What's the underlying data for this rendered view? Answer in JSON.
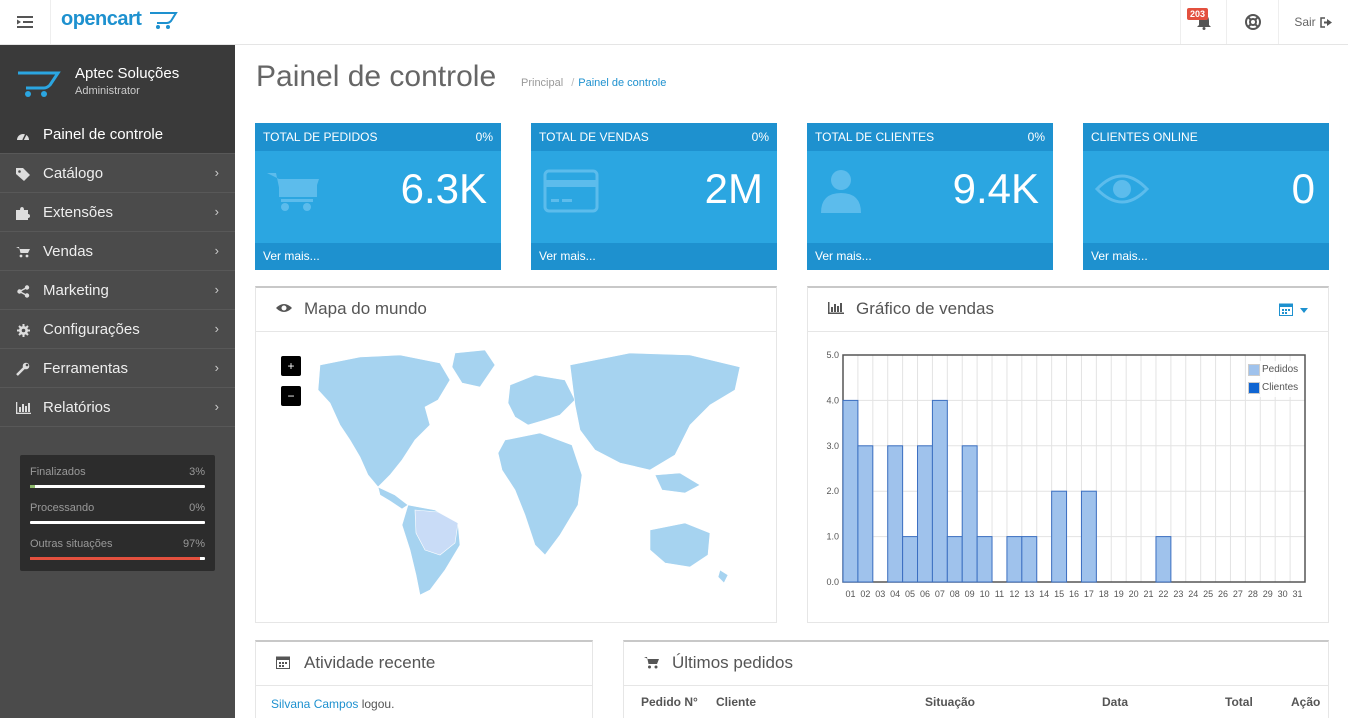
{
  "header": {
    "logo_text": "opencart",
    "notifications_count": "203",
    "logout_label": "Sair"
  },
  "sidebar": {
    "profile": {
      "name": "Aptec Soluções",
      "role": "Administrator"
    },
    "items": [
      {
        "label": "Painel de controle",
        "icon": "dashboard-icon",
        "active": true
      },
      {
        "label": "Catálogo",
        "icon": "tags-icon"
      },
      {
        "label": "Extensões",
        "icon": "puzzle-icon"
      },
      {
        "label": "Vendas",
        "icon": "cart-icon"
      },
      {
        "label": "Marketing",
        "icon": "share-icon"
      },
      {
        "label": "Configurações",
        "icon": "gear-icon"
      },
      {
        "label": "Ferramentas",
        "icon": "wrench-icon"
      },
      {
        "label": "Relatórios",
        "icon": "bar-chart-icon"
      }
    ],
    "progress": [
      {
        "label": "Finalizados",
        "value": "3%",
        "fraction": 0.03,
        "color": "#8fbb6c"
      },
      {
        "label": "Processando",
        "value": "0%",
        "fraction": 0.0,
        "color": "#f0ad4e"
      },
      {
        "label": "Outras situações",
        "value": "97%",
        "fraction": 0.97,
        "color": "#e3503e"
      }
    ]
  },
  "page": {
    "title": "Painel de controle",
    "breadcrumb": [
      "Principal",
      "Painel de controle"
    ]
  },
  "tiles": [
    {
      "title": "TOTAL DE PEDIDOS",
      "pct": "0%",
      "value": "6.3K",
      "footer": "Ver mais...",
      "icon": "shopping-cart-icon"
    },
    {
      "title": "TOTAL DE VENDAS",
      "pct": "0%",
      "value": "2M",
      "footer": "Ver mais...",
      "icon": "credit-card-icon"
    },
    {
      "title": "TOTAL DE CLIENTES",
      "pct": "0%",
      "value": "9.4K",
      "footer": "Ver mais...",
      "icon": "user-icon"
    },
    {
      "title": "CLIENTES ONLINE",
      "pct": "",
      "value": "0",
      "footer": "Ver mais...",
      "icon": "eye-icon"
    }
  ],
  "map_panel": {
    "title": "Mapa do mundo",
    "zoom_in": "+",
    "zoom_out": "−"
  },
  "sales_panel": {
    "title": "Gráfico de vendas"
  },
  "activity_panel": {
    "title": "Atividade recente",
    "entry_user": "Silvana Campos",
    "entry_action": " logou."
  },
  "orders_panel": {
    "title": "Últimos pedidos",
    "columns": [
      "Pedido N°",
      "Cliente",
      "Situação",
      "Data",
      "Total",
      "Ação"
    ]
  },
  "chart_data": {
    "type": "bar",
    "categories": [
      "01",
      "02",
      "03",
      "04",
      "05",
      "06",
      "07",
      "08",
      "09",
      "10",
      "11",
      "12",
      "13",
      "14",
      "15",
      "16",
      "17",
      "18",
      "19",
      "20",
      "21",
      "22",
      "23",
      "24",
      "25",
      "26",
      "27",
      "28",
      "29",
      "30",
      "31"
    ],
    "series": [
      {
        "name": "Pedidos",
        "color": "#9fc2ec",
        "values": [
          4,
          3,
          0,
          3,
          1,
          3,
          4,
          1,
          3,
          1,
          0,
          1,
          1,
          0,
          2,
          0,
          2,
          0,
          0,
          0,
          0,
          1,
          0,
          0,
          0,
          0,
          0,
          0,
          0,
          0,
          0
        ]
      },
      {
        "name": "Clientes",
        "color": "#1065d2",
        "values": [
          0,
          0,
          0,
          0,
          0,
          0,
          0,
          0,
          0,
          0,
          0,
          0,
          0,
          0,
          0,
          0,
          0,
          0,
          0,
          0,
          0,
          0,
          0,
          0,
          0,
          0,
          0,
          0,
          0,
          0,
          0
        ]
      }
    ],
    "y_ticks": [
      "0.0",
      "1.0",
      "2.0",
      "3.0",
      "4.0",
      "5.0"
    ],
    "ylim": [
      0,
      5
    ],
    "grid": true,
    "legend": "top-right"
  }
}
